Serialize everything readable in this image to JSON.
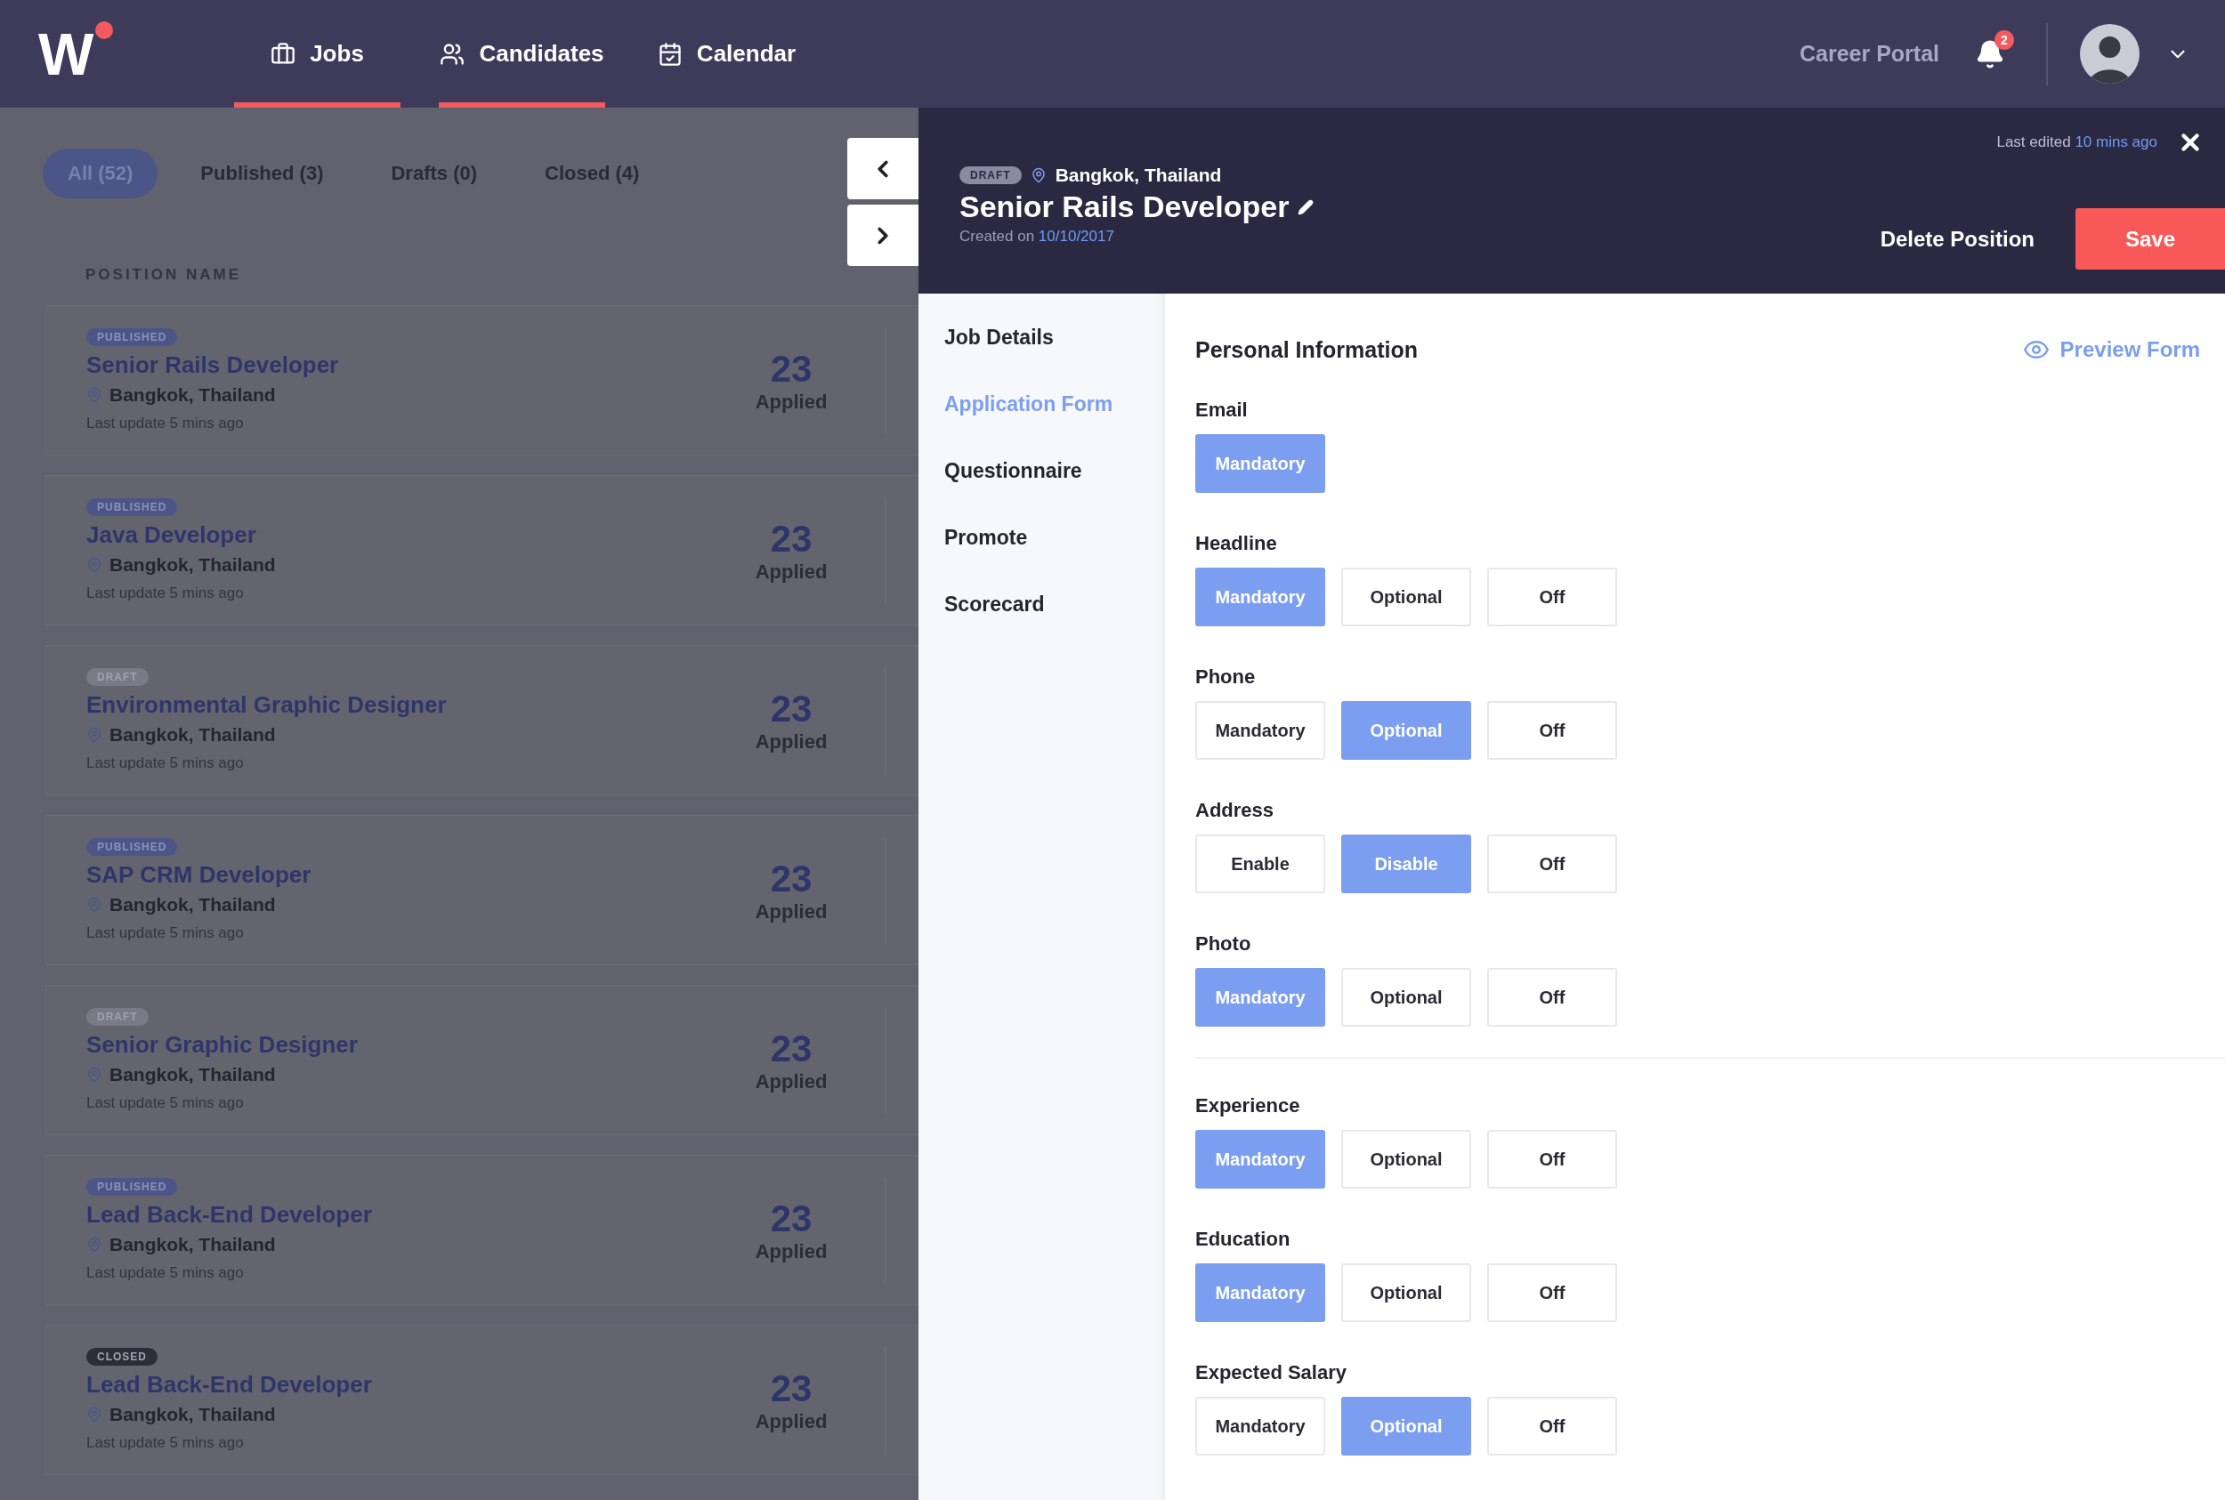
{
  "nav": {
    "logo": "W",
    "tabs": [
      {
        "label": "Jobs",
        "selected": true
      },
      {
        "label": "Candidates",
        "selected": true
      },
      {
        "label": "Calendar",
        "selected": false
      }
    ],
    "career_portal": "Career Portal",
    "notifications": "2"
  },
  "filters": [
    {
      "label": "All (52)",
      "selected": true
    },
    {
      "label": "Published (3)",
      "selected": false
    },
    {
      "label": "Drafts (0)",
      "selected": false
    },
    {
      "label": "Closed (4)",
      "selected": false
    }
  ],
  "list": {
    "column": "POSITION NAME",
    "positions": [
      {
        "kind": "published",
        "status": "PUBLISHED",
        "title": "Senior Rails Developer",
        "location": "Bangkok, Thailand",
        "updated": "Last update 5 mins ago",
        "count": "23",
        "count_label": "Applied"
      },
      {
        "kind": "published",
        "status": "PUBLISHED",
        "title": "Java Developer",
        "location": "Bangkok, Thailand",
        "updated": "Last update 5 mins ago",
        "count": "23",
        "count_label": "Applied"
      },
      {
        "kind": "draft",
        "status": "DRAFT",
        "title": "Environmental Graphic Designer",
        "location": "Bangkok, Thailand",
        "updated": "Last update 5 mins ago",
        "count": "23",
        "count_label": "Applied"
      },
      {
        "kind": "published",
        "status": "PUBLISHED",
        "title": "SAP CRM Developer",
        "location": "Bangkok, Thailand",
        "updated": "Last update 5 mins ago",
        "count": "23",
        "count_label": "Applied"
      },
      {
        "kind": "draft",
        "status": "DRAFT",
        "title": "Senior Graphic Designer",
        "location": "Bangkok, Thailand",
        "updated": "Last update 5 mins ago",
        "count": "23",
        "count_label": "Applied"
      },
      {
        "kind": "published",
        "status": "PUBLISHED",
        "title": "Lead Back-End Developer",
        "location": "Bangkok, Thailand",
        "updated": "Last update 5 mins ago",
        "count": "23",
        "count_label": "Applied"
      },
      {
        "kind": "closed",
        "status": "CLOSED",
        "title": "Lead Back-End Developer",
        "location": "Bangkok, Thailand",
        "updated": "Last update 5 mins ago",
        "count": "23",
        "count_label": "Applied"
      }
    ]
  },
  "panel": {
    "status": "DRAFT",
    "location": "Bangkok, Thailand",
    "title": "Senior Rails Developer",
    "created_prefix": "Created on",
    "created_date": "10/10/2017",
    "edited_prefix": "Last edited",
    "edited_time": "10 mins ago",
    "delete": "Delete Position",
    "save": "Save"
  },
  "sections": [
    {
      "label": "Job Details",
      "selected": false
    },
    {
      "label": "Application Form",
      "selected": true
    },
    {
      "label": "Questionnaire",
      "selected": false
    },
    {
      "label": "Promote",
      "selected": false
    },
    {
      "label": "Scorecard",
      "selected": false
    }
  ],
  "form": {
    "title": "Personal Information",
    "preview": "Preview Form",
    "groups": [
      {
        "fields": [
          {
            "label": "Email",
            "options": [
              {
                "label": "Mandatory",
                "selected": true
              }
            ]
          },
          {
            "label": "Headline",
            "options": [
              {
                "label": "Mandatory",
                "selected": true
              },
              {
                "label": "Optional",
                "selected": false
              },
              {
                "label": "Off",
                "selected": false
              }
            ]
          },
          {
            "label": "Phone",
            "options": [
              {
                "label": "Mandatory",
                "selected": false
              },
              {
                "label": "Optional",
                "selected": true
              },
              {
                "label": "Off",
                "selected": false
              }
            ]
          },
          {
            "label": "Address",
            "options": [
              {
                "label": "Enable",
                "selected": false
              },
              {
                "label": "Disable",
                "selected": true
              },
              {
                "label": "Off",
                "selected": false
              }
            ]
          },
          {
            "label": "Photo",
            "options": [
              {
                "label": "Mandatory",
                "selected": true
              },
              {
                "label": "Optional",
                "selected": false
              },
              {
                "label": "Off",
                "selected": false
              }
            ]
          }
        ]
      },
      {
        "fields": [
          {
            "label": "Experience",
            "options": [
              {
                "label": "Mandatory",
                "selected": true
              },
              {
                "label": "Optional",
                "selected": false
              },
              {
                "label": "Off",
                "selected": false
              }
            ]
          },
          {
            "label": "Education",
            "options": [
              {
                "label": "Mandatory",
                "selected": true
              },
              {
                "label": "Optional",
                "selected": false
              },
              {
                "label": "Off",
                "selected": false
              }
            ]
          },
          {
            "label": "Expected Salary",
            "options": [
              {
                "label": "Mandatory",
                "selected": false
              },
              {
                "label": "Optional",
                "selected": true
              },
              {
                "label": "Off",
                "selected": false
              }
            ]
          }
        ]
      }
    ]
  }
}
